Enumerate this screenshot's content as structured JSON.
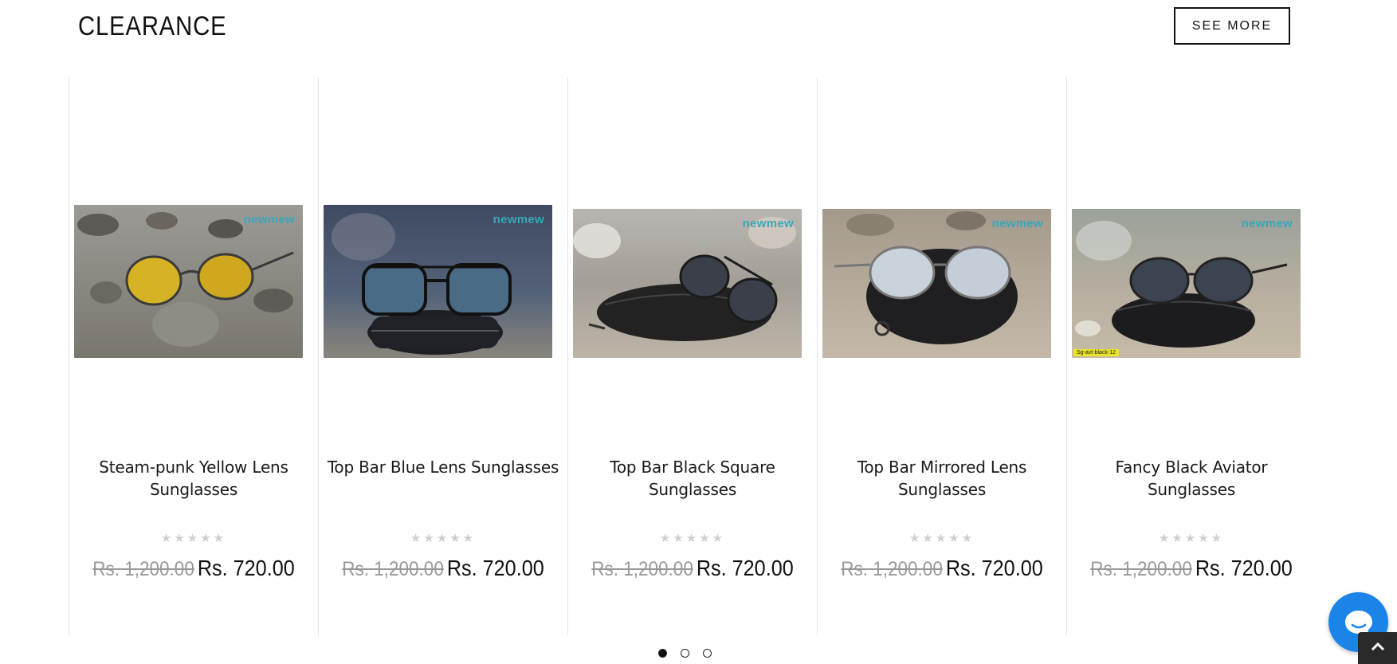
{
  "section": {
    "title": "CLEARANCE",
    "see_more_label": "SEE MORE"
  },
  "products": [
    {
      "name": "Steam-punk Yellow Lens Sunglasses",
      "old_price": "Rs. 1,200.00",
      "new_price": "Rs. 720.00",
      "brand": "newmew",
      "stars": "★★★★★",
      "rating": 0
    },
    {
      "name": "Top Bar Blue Lens Sunglasses",
      "old_price": "Rs. 1,200.00",
      "new_price": "Rs. 720.00",
      "brand": "newmew",
      "stars": "★★★★★",
      "rating": 0
    },
    {
      "name": "Top Bar Black Square Sunglasses",
      "old_price": "Rs. 1,200.00",
      "new_price": "Rs. 720.00",
      "brand": "newmew",
      "stars": "★★★★★",
      "rating": 0
    },
    {
      "name": "Top Bar Mirrored Lens Sunglasses",
      "old_price": "Rs. 1,200.00",
      "new_price": "Rs. 720.00",
      "brand": "newmew",
      "stars": "★★★★★",
      "rating": 0
    },
    {
      "name": "Fancy Black Aviator Sunglasses",
      "old_price": "Rs. 1,200.00",
      "new_price": "Rs. 720.00",
      "brand": "newmew",
      "stars": "★★★★★",
      "rating": 0,
      "sku": "Sg-avt-black-12"
    }
  ],
  "carousel": {
    "pages": 3,
    "active_page": 1
  },
  "colors": {
    "accent_chat": "#1a84e8",
    "brand_text": "#3ba6b8",
    "rating_star": "#cfcfcf",
    "old_price": "#999999"
  },
  "icons": {
    "chat": "chat-bubble-icon",
    "scroll_top": "chevron-up-icon",
    "rating": "star-icon"
  }
}
